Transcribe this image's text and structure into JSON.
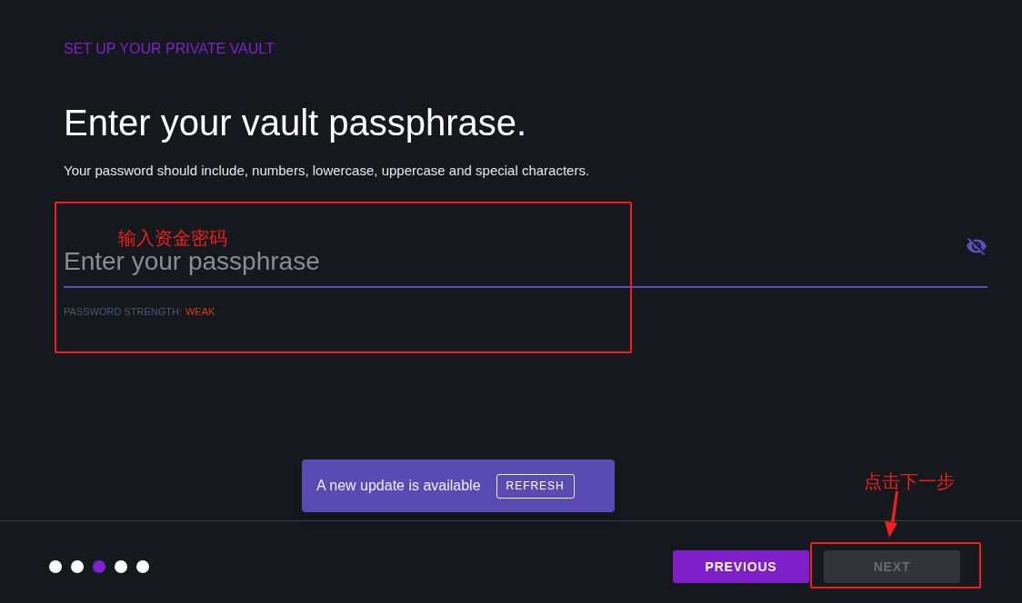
{
  "header": {
    "eyebrow": "SET UP YOUR PRIVATE VAULT",
    "title": "Enter your vault passphrase.",
    "hint": "Your password should include, numbers, lowercase, uppercase and special characters."
  },
  "passphrase_field": {
    "placeholder": "Enter your passphrase",
    "password_visible": false,
    "strength_label": "PASSWORD STRENGTH:",
    "strength_value": "WEAK"
  },
  "toast": {
    "message": "A new update is available",
    "action": "REFRESH"
  },
  "steps": [
    {
      "selected": false
    },
    {
      "selected": false
    },
    {
      "selected": true
    },
    {
      "selected": false
    },
    {
      "selected": false
    }
  ],
  "buttons": [
    {
      "label": "PREVIOUS",
      "disabled": false
    },
    {
      "label": "NEXT",
      "disabled": true
    }
  ],
  "annotations": [
    {
      "kind": "box_label",
      "text": "输入资金密码"
    },
    {
      "kind": "arrow_label",
      "text": "点击下一步"
    }
  ]
}
